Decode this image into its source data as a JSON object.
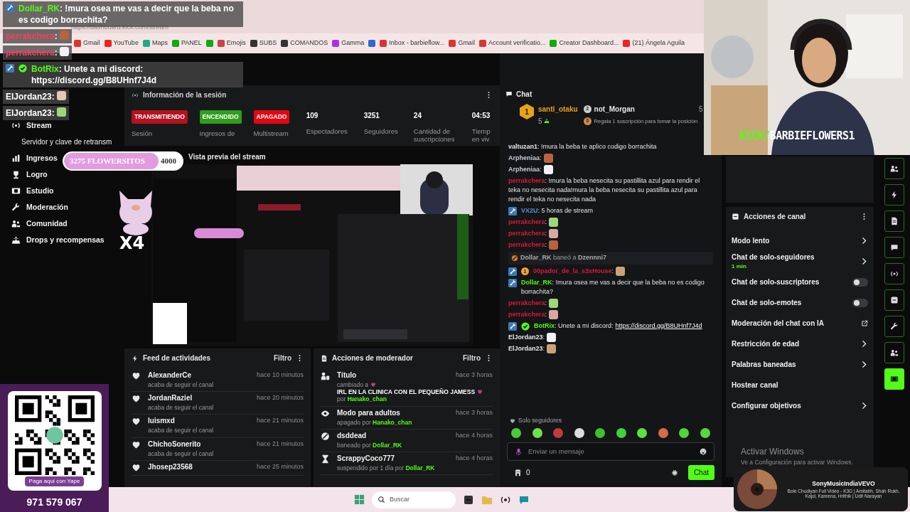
{
  "browser": {
    "address": "https://dashboard.kick.com/stream",
    "bookmarks": [
      {
        "kind": "link",
        "label": "Gmail"
      },
      {
        "kind": "link",
        "label": "YouTube"
      },
      {
        "kind": "link",
        "label": "Maps"
      },
      {
        "kind": "link",
        "label": "PANEL"
      },
      {
        "kind": "icon"
      },
      {
        "kind": "link",
        "label": "Emojis"
      },
      {
        "kind": "link",
        "label": "SUBS"
      },
      {
        "kind": "link",
        "label": "COMANDOS"
      },
      {
        "kind": "link",
        "label": "Gamma"
      },
      {
        "kind": "icon"
      },
      {
        "kind": "link",
        "label": "Inbox - barbieflow..."
      },
      {
        "kind": "link",
        "label": "Gmail"
      },
      {
        "kind": "link",
        "label": "Account verificatio..."
      },
      {
        "kind": "link",
        "label": "Creator Dashboard..."
      },
      {
        "kind": "link",
        "label": "(21) Ángela Aguila"
      }
    ]
  },
  "overlay_chat": [
    {
      "user": "Dollar_RK",
      "sep": ":",
      "color": "#53fc18",
      "badges": [
        {
          "kind": "mod"
        }
      ],
      "text": "!mura osea me vas a decir que la beba no es codigo borrachita?"
    },
    {
      "user": "perrakchera",
      "sep": ":",
      "color": "#ff3b5c",
      "emote": true
    },
    {
      "user": "perrakchera",
      "sep": ":",
      "color": "#ff3b5c",
      "emote": true
    },
    {
      "user": "BotRix",
      "sep": ":",
      "color": "#53fc18",
      "badges": [
        {
          "kind": "mod"
        },
        {
          "kind": "verified"
        }
      ],
      "text": "Unete a mi discord: https://discord.gg/B8UHnf7J4d"
    },
    {
      "user": "ElJordan23",
      "sep": ":",
      "color": "#ffffff",
      "emote": true
    },
    {
      "user": "ElJordan23",
      "sep": ":",
      "color": "#ffffff",
      "emote": true
    }
  ],
  "sidebar": {
    "items": [
      {
        "kind": "main",
        "label": "Stream"
      },
      {
        "kind": "sub",
        "label": "Servidor y clave de retransm"
      },
      {
        "kind": "main",
        "label": "Ingresos"
      },
      {
        "kind": "main",
        "label": "Logro"
      },
      {
        "kind": "main",
        "label": "Estudio"
      },
      {
        "kind": "main",
        "label": "Moderación"
      },
      {
        "kind": "main",
        "label": "Comunidad"
      },
      {
        "kind": "main",
        "label": "Drops y recompensas"
      }
    ]
  },
  "goal": {
    "current": "3275 FLOWERSITOS",
    "target": "4000",
    "level": 0.8
  },
  "sticker": {
    "text": "X4"
  },
  "session": {
    "title": "Información de la sesión",
    "stats": [
      {
        "kind": "badge",
        "value": "TRANSMITIENDO",
        "color": "#b3121f",
        "label": "Sesión"
      },
      {
        "kind": "badge",
        "value": "ENCENDIDO",
        "color": "#2f9e1c",
        "label": "Ingresos de"
      },
      {
        "kind": "badge",
        "value": "APAGADO",
        "color": "#e30613",
        "label": "Multistream"
      },
      {
        "kind": "number",
        "value": "109",
        "label": "Espectadores"
      },
      {
        "kind": "number",
        "value": "3251",
        "label": "Seguidores"
      },
      {
        "kind": "number",
        "value": "24",
        "label": "Cantidad de suscripciones"
      },
      {
        "kind": "number",
        "value": "04:53",
        "label": "Tiemp en viv"
      }
    ]
  },
  "preview": {
    "title": "Vista previa del stream",
    "kind": "picture"
  },
  "feed": {
    "title": "Feed de actividades",
    "filter": "Filtro",
    "items": [
      {
        "name": "AlexanderCe",
        "note": "acaba de seguir el canal",
        "time": "hace 10 minutos"
      },
      {
        "name": "JordanRaziel",
        "note": "acaba de seguir el canal",
        "time": "hace 20 minutos"
      },
      {
        "name": "luismxd",
        "note": "acaba de seguir el canal",
        "time": "hace 21 minutos"
      },
      {
        "name": "ChichoSonerito",
        "note": "acaba de seguir el canal",
        "time": "hace 21 minutos"
      },
      {
        "name": "Jhosep23568",
        "time": "hace 25 minutos"
      }
    ]
  },
  "mod_actions": {
    "title": "Acciones de moderador",
    "filter": "Filtro",
    "items": [
      {
        "kind": "title",
        "title": "Título",
        "time": "hace 3 horas",
        "note": "cambiado a",
        "target": "IRL EN LA CLINICA CON EL PEQUEÑO JAMESS",
        "by_label": "por",
        "by": "Hanako_chan"
      },
      {
        "kind": "adult",
        "title": "Modo para adultos",
        "time": "hace 3 horas",
        "note": "apagado por",
        "by": "Hanako_chan"
      },
      {
        "kind": "ban",
        "title": "dsddead",
        "time": "hace 4 horas",
        "note": "baneado por",
        "by": "Dollar_RK"
      },
      {
        "kind": "timeout",
        "title": "ScrappyCoco777",
        "time": "hace 4 horas",
        "note": "suspendido por 1 día por",
        "by": "Dollar_RK"
      }
    ]
  },
  "chat": {
    "title": "Chat",
    "leaderboard": [
      {
        "rank": "1",
        "name": "santi_otaku",
        "count": "5"
      },
      {
        "rank": "2",
        "name": "not_Morgan",
        "count": "5"
      },
      {
        "rank": "3",
        "prompt": "Regala 1 suscripción para tomar la posición"
      }
    ],
    "messages": [
      {
        "kind": "message",
        "user": "valtuzan1",
        "sep": ":",
        "color": "#e8e8e8",
        "text": "!mura la beba te aplico codigo borrachita"
      },
      {
        "kind": "message",
        "user": "Arpheniaa",
        "sep": ":",
        "color": "#c9c9d6",
        "emote": true
      },
      {
        "kind": "message",
        "user": "Arpheniaa",
        "sep": ":",
        "color": "#c9c9d6",
        "emote": true
      },
      {
        "kind": "message",
        "user": "perrakchera",
        "sep": ":",
        "color": "#d81a3c",
        "text": "!mura la beba nesecita su pastillita azul para rendir el teka no nesecita nada!mura la beba nesecita su pastillita azul para rendir el teka no nesecita nada"
      },
      {
        "kind": "message",
        "user": "VX2U",
        "sep": ":",
        "color": "#5b8fd6",
        "badges": [
          {
            "kind": "mod"
          }
        ],
        "text": "5 horas de stream"
      },
      {
        "kind": "message",
        "user": "perrakchera",
        "sep": ":",
        "color": "#d81a3c",
        "emote": true
      },
      {
        "kind": "message",
        "user": "perrakchera",
        "sep": ":",
        "color": "#d81a3c",
        "emote": true
      },
      {
        "kind": "message",
        "user": "perrakchera",
        "sep": ":",
        "color": "#d81a3c",
        "emote": true
      },
      {
        "kind": "ban",
        "actor": "Dollar_RK",
        "verb": "baneó a",
        "target": "Dzennni7"
      },
      {
        "kind": "message",
        "user": "00pador_de_la_s3xHouse",
        "sep": ":",
        "color": "#d81a3c",
        "badges": [
          {
            "kind": "mod"
          },
          {
            "kind": "sub",
            "label": "1"
          }
        ],
        "emote": true
      },
      {
        "kind": "message",
        "user": "Dollar_RK",
        "sep": ":",
        "color": "#53fc18",
        "badges": [
          {
            "kind": "mod"
          }
        ],
        "text": "!mura osea me vas a decir que la beba no es codigo borrachita?"
      },
      {
        "kind": "message",
        "user": "perrakchera",
        "sep": ":",
        "color": "#d81a3c",
        "emote": true
      },
      {
        "kind": "message",
        "user": "perrakchera",
        "sep": ":",
        "color": "#d81a3c",
        "emote": true
      },
      {
        "kind": "message",
        "user": "BotRix",
        "sep": ":",
        "color": "#53fc18",
        "badges": [
          {
            "kind": "mod"
          },
          {
            "kind": "verified"
          }
        ],
        "text": "Unete a mi discord:",
        "link": "https://discord.gg/B8UHnf7J4d"
      },
      {
        "kind": "message",
        "user": "ElJordan23",
        "sep": ":",
        "color": "#e8e8e8",
        "emote": true
      },
      {
        "kind": "message",
        "user": "ElJordan23",
        "sep": ":",
        "color": "#e8e8e8",
        "emote": true
      }
    ],
    "followers_only": "Solo seguidores",
    "input": {
      "placeholder": "Enviar un mensaje"
    },
    "points": "0",
    "send": "Chat"
  },
  "channel_actions": {
    "title": "Acciones de canal",
    "items": [
      {
        "kind": "link",
        "label": "Modo lento"
      },
      {
        "kind": "link",
        "label": "Chat de solo-seguidores",
        "note": "1 min"
      },
      {
        "kind": "toggle",
        "label": "Chat de solo-suscriptores",
        "on": false
      },
      {
        "kind": "toggle",
        "label": "Chat de solo-emotes",
        "on": false
      },
      {
        "kind": "external",
        "label": "Moderación del chat con IA"
      },
      {
        "kind": "link",
        "label": "Restricción de edad"
      },
      {
        "kind": "link",
        "label": "Palabras baneadas"
      },
      {
        "kind": "plain",
        "label": "Hostear canal"
      },
      {
        "kind": "link",
        "label": "Configurar objetivos"
      }
    ]
  },
  "rail": [
    {
      "selected": false
    },
    {
      "selected": false
    },
    {
      "selected": false
    },
    {
      "selected": false
    },
    {
      "selected": false
    },
    {
      "selected": false
    },
    {
      "selected": false
    },
    {
      "selected": false
    },
    {
      "selected": true
    }
  ],
  "webcam": {
    "kind": "picture",
    "caption_accent": "KICK/",
    "caption": "BARBIEFLOWERS1"
  },
  "qr": {
    "caption": "Paga aquí con Yape",
    "phone": "971 579 067"
  },
  "windows": {
    "activation_title": "Activar Windows",
    "activation_note": "Ve a Configuración para activar Windows."
  },
  "taskbar": {
    "search_placeholder": "Buscar"
  },
  "media": {
    "channel": "SonyMusicIndiaVEVO",
    "title": "Bole Chudiyan Full Video - K3G | Amitabh, Shah Rukh, Kajol, Kareena, Hrithik | Udit Narayan"
  }
}
